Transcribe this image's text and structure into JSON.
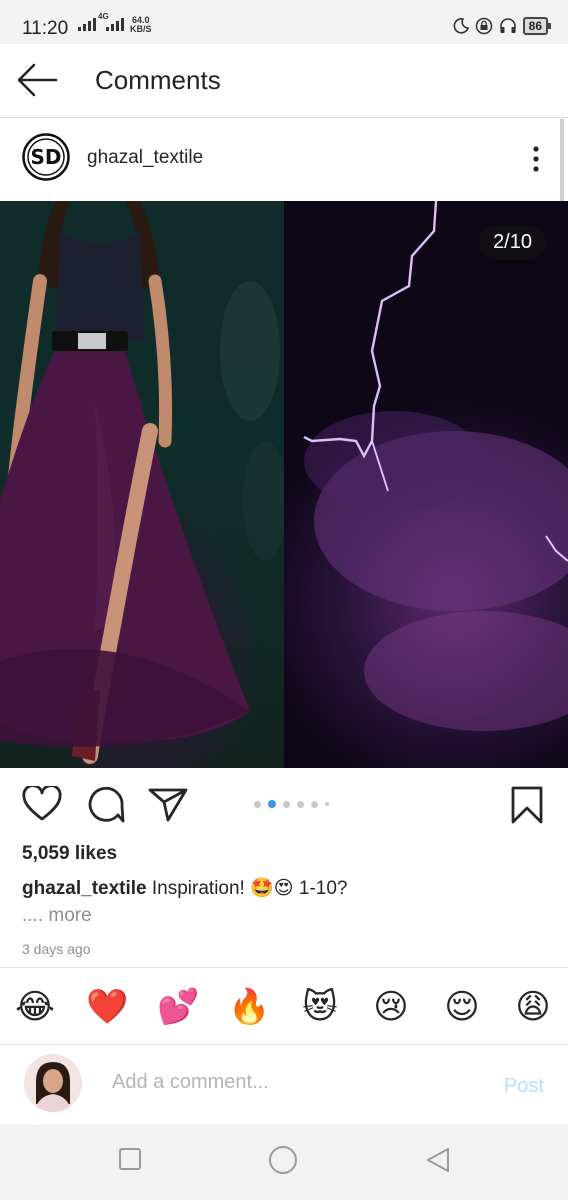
{
  "status_bar": {
    "time": "11:20",
    "network": "4G",
    "speed_value": "64.0",
    "speed_unit": "KB/S",
    "battery": "86"
  },
  "header": {
    "title": "Comments"
  },
  "post": {
    "username": "ghazal_textile",
    "image_counter": "2/10",
    "carousel": {
      "total_dots": 6,
      "active_index": 1
    },
    "likes": "5,059 likes",
    "caption_user": "ghazal_textile",
    "caption_text_1": "Inspiration!",
    "caption_emojis": "🤩😍",
    "caption_text_2": "1-10?",
    "more": ".... more",
    "time_ago": "3 days ago"
  },
  "emoji_bar": [
    "😂",
    "❤️",
    "💕",
    "🔥",
    "😻",
    "😢",
    "😌",
    "😩"
  ],
  "comment": {
    "placeholder": "Add a comment...",
    "post_label": "Post"
  },
  "colors": {
    "accent": "#3897f0",
    "post_disabled": "#b2dffc",
    "text": "#262626",
    "muted": "#8e8e8e"
  }
}
